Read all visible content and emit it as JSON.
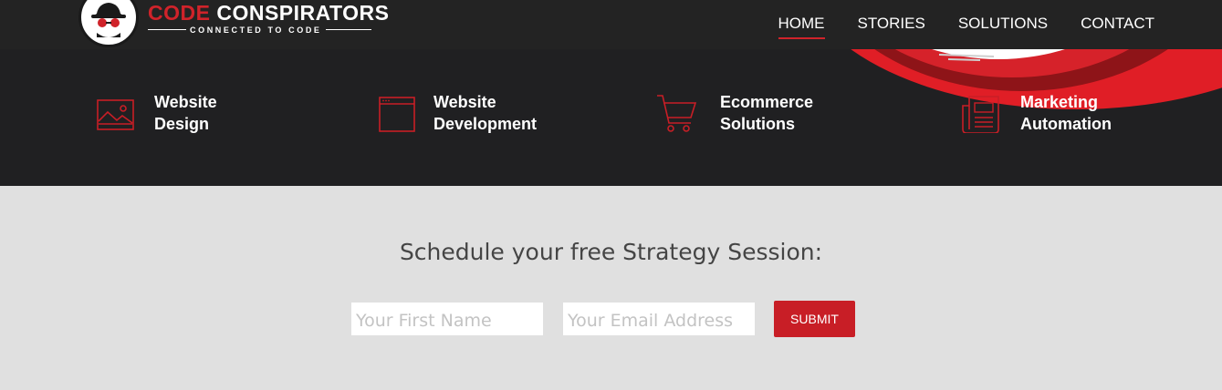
{
  "brand": {
    "name_part1": "CODE",
    "name_part2": "CONSPIRATORS",
    "tagline": "CONNECTED TO CODE",
    "logo_icon": "spy-hat-sunglasses-icon",
    "accent_color": "#d0232a"
  },
  "nav": {
    "items": [
      {
        "label": "HOME",
        "active": true
      },
      {
        "label": "STORIES",
        "active": false
      },
      {
        "label": "SOLUTIONS",
        "active": false
      },
      {
        "label": "CONTACT",
        "active": false
      }
    ]
  },
  "services": [
    {
      "line1": "Website",
      "line2": "Design",
      "icon": "image-frame-icon"
    },
    {
      "line1": "Website",
      "line2": "Development",
      "icon": "browser-window-icon"
    },
    {
      "line1": "Ecommerce",
      "line2": "Solutions",
      "icon": "shopping-cart-icon"
    },
    {
      "line1": "Marketing",
      "line2": "Automation",
      "icon": "newspaper-icon"
    }
  ],
  "session": {
    "title": "Schedule your free Strategy Session:",
    "first_name_placeholder": "Your First Name",
    "email_placeholder": "Your Email Address",
    "submit_label": "SUBMIT"
  },
  "colors": {
    "dark_bg": "#202022",
    "light_bg": "#e0e0e0",
    "button_red": "#c81e26"
  }
}
